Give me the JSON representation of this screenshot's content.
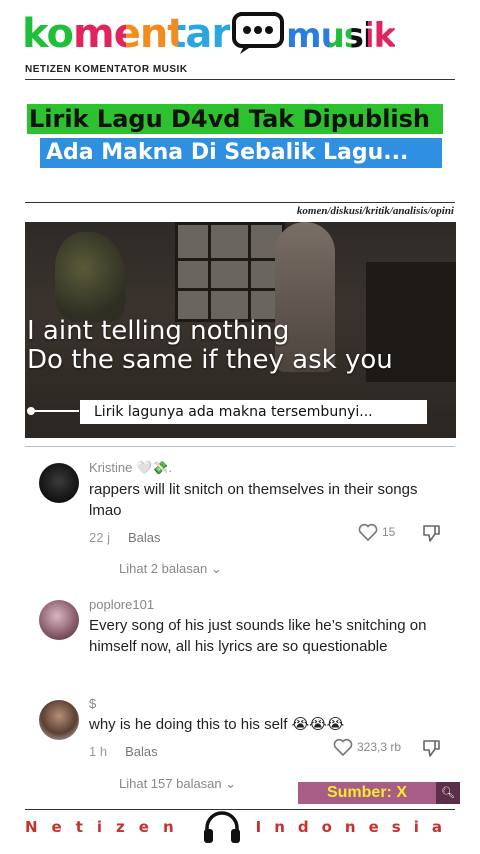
{
  "brand": {
    "logo_part1": "komentar",
    "logo_part2": "musik",
    "tagline": "NETIZEN KOMENTATOR MUSIK"
  },
  "headline": {
    "line1": "Lirik Lagu D4vd Tak Dipublish",
    "line2": "Ada Makna Di Sebalik Lagu..."
  },
  "categories": "komen/diskusi/kritik/analisis/opini",
  "video": {
    "lyric_line1": "I aint telling nothing",
    "lyric_line2": "Do the same if they ask you",
    "caption": "Lirik lagunya ada makna tersembunyi..."
  },
  "comments": [
    {
      "username": "Kristine 🤍💸.",
      "text": "rappers will lit snitch on themselves in their songs lmao",
      "time": "22 j",
      "reply_label": "Balas",
      "likes": "15",
      "view_replies": "Lihat 2 balasan"
    },
    {
      "username": "poplore101",
      "text": "Every song of his just sounds like he’s snitching on himself now, all his lyrics are so questionable"
    },
    {
      "username": "$",
      "text": "why is he doing this to his self 😭😭😭",
      "time": "1 h",
      "reply_label": "Balas",
      "likes": "323,3 rb",
      "view_replies": "Lihat 157 balasan"
    }
  ],
  "source": {
    "label": "Sumber: X",
    "button_icon": "search-icon"
  },
  "footer": {
    "left": "Netizen",
    "right": "Indonesia",
    "icon": "headphones-icon"
  },
  "colors": {
    "headline1_bg": "#2ec12f",
    "headline2_bg": "#2f8fe0",
    "footer_text": "#c7322f",
    "source_bg": "#a85d86",
    "source_text": "#f7ea2a"
  }
}
